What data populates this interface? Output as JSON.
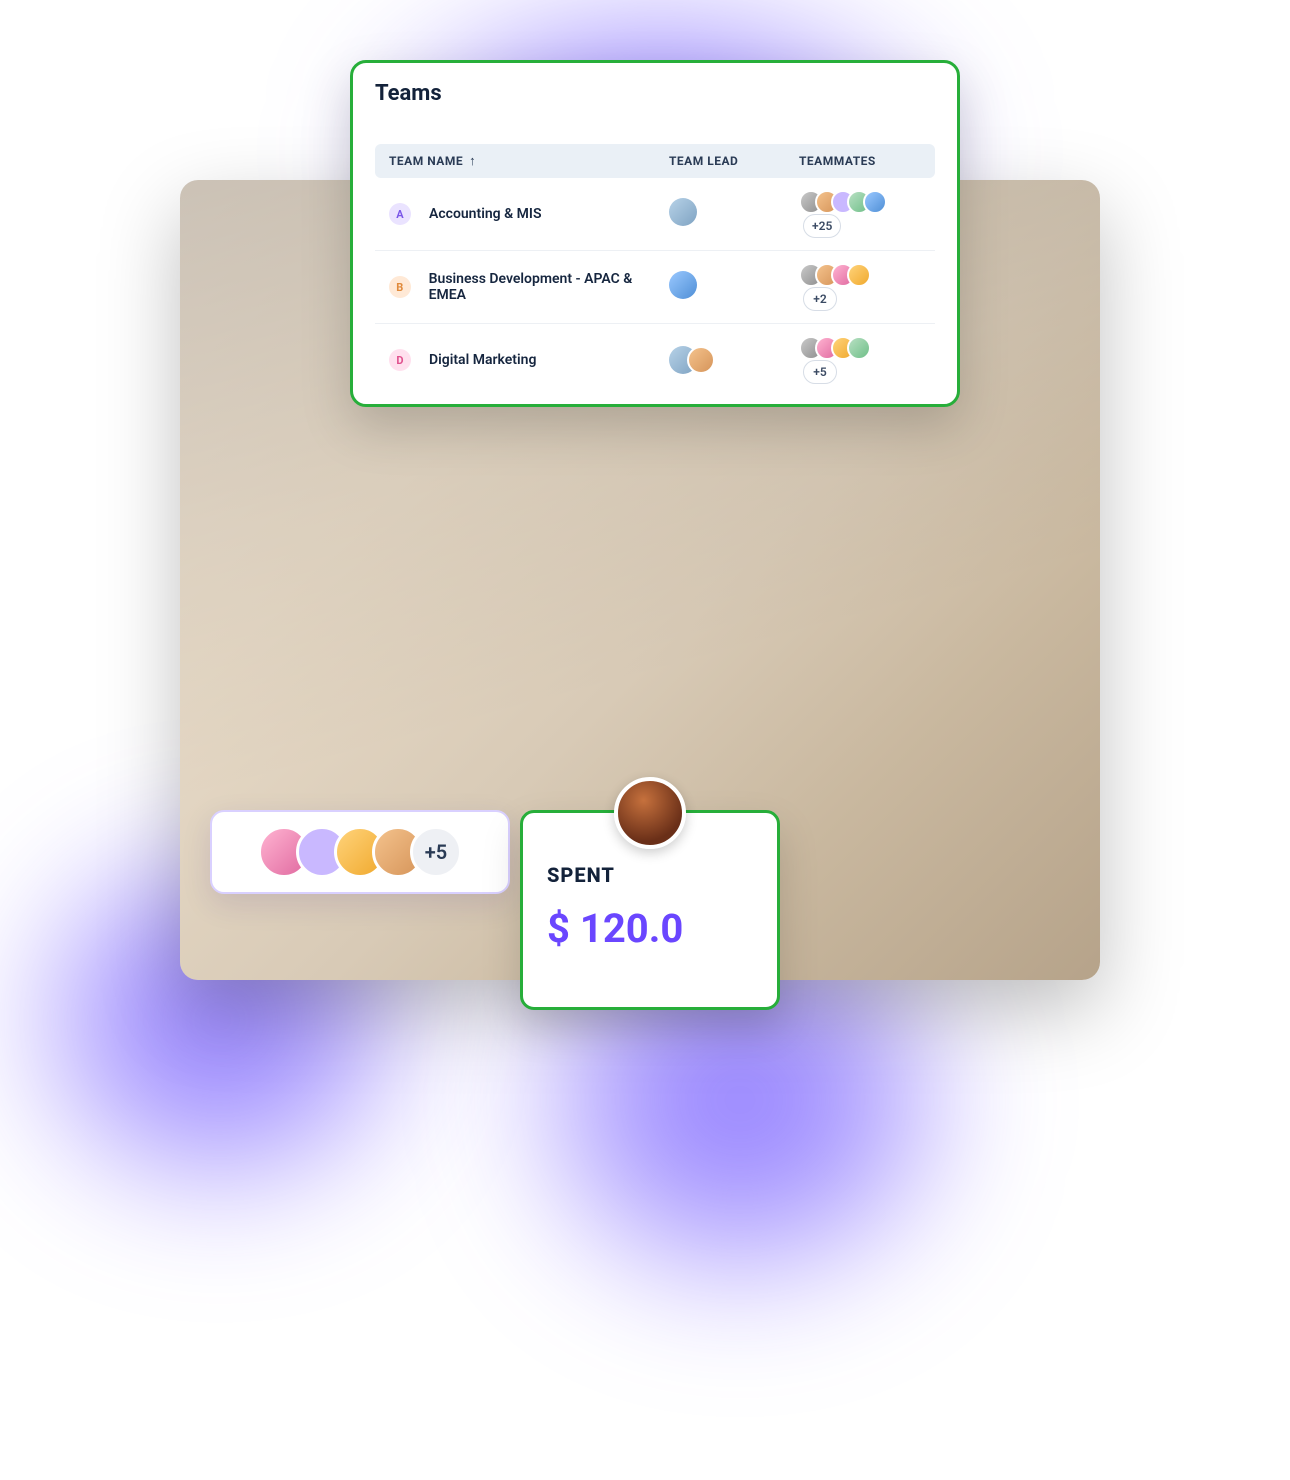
{
  "teams_panel": {
    "title": "Teams",
    "columns": {
      "name": "TEAM NAME",
      "lead": "TEAM LEAD",
      "mates": "TEAMMATES"
    },
    "sort_indicator": "↑",
    "rows": [
      {
        "badge": "A",
        "name": "Accounting & MIS",
        "more": "+25"
      },
      {
        "badge": "B",
        "name": "Business Development - APAC & EMEA",
        "more": "+2"
      },
      {
        "badge": "D",
        "name": "Digital Marketing",
        "more": "+5"
      }
    ]
  },
  "avatar_strip": {
    "more": "+5"
  },
  "spent_card": {
    "label": "SPENT",
    "value": "$ 120.0"
  }
}
